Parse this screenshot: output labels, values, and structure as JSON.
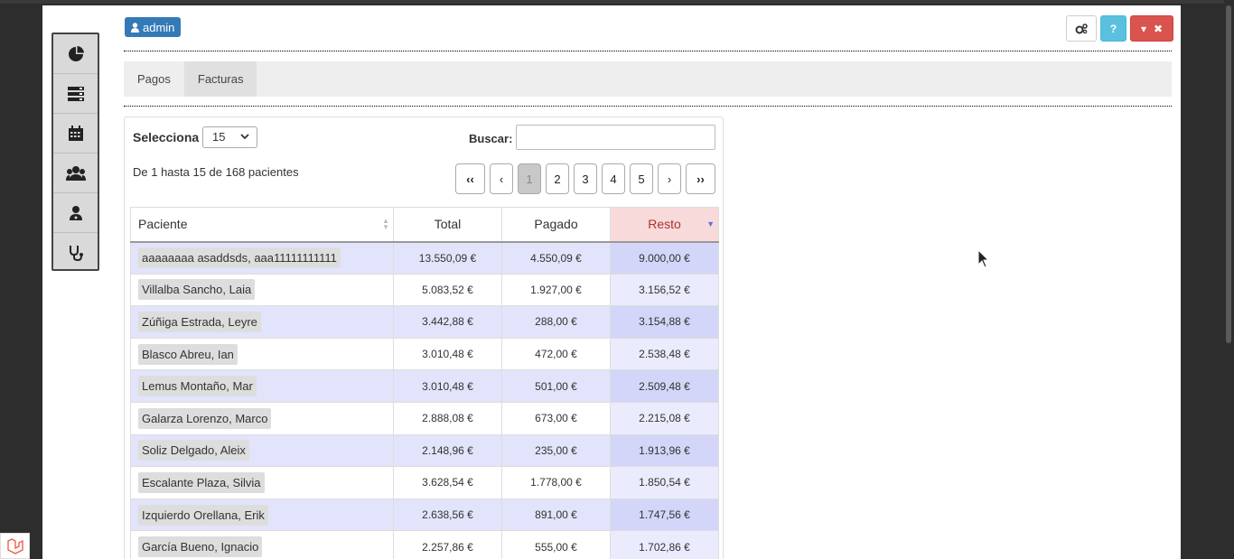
{
  "user": {
    "name": "admin"
  },
  "toolbar": {
    "help_label": "?"
  },
  "tabs": [
    {
      "label": "Pagos"
    },
    {
      "label": "Facturas"
    }
  ],
  "table_controls": {
    "select_label": "Selecciona",
    "page_size": "15",
    "search_label": "Buscar:",
    "search_value": "",
    "info": "De 1 hasta 15 de 168 pacientes"
  },
  "pagination": {
    "first": "‹‹",
    "prev": "‹",
    "pages": [
      "1",
      "2",
      "3",
      "4",
      "5"
    ],
    "current": "1",
    "next": "›",
    "last": "››"
  },
  "columns": {
    "paciente": "Paciente",
    "total": "Total",
    "pagado": "Pagado",
    "resto": "Resto"
  },
  "rows": [
    {
      "paciente": "aaaaaaaa asaddsds, aaa11111111111",
      "total": "13.550,09 €",
      "pagado": "4.550,09 €",
      "resto": "9.000,00 €"
    },
    {
      "paciente": "Villalba Sancho, Laia",
      "total": "5.083,52 €",
      "pagado": "1.927,00 €",
      "resto": "3.156,52 €"
    },
    {
      "paciente": "Zúñiga Estrada, Leyre",
      "total": "3.442,88 €",
      "pagado": "288,00 €",
      "resto": "3.154,88 €"
    },
    {
      "paciente": "Blasco Abreu, Ian",
      "total": "3.010,48 €",
      "pagado": "472,00 €",
      "resto": "2.538,48 €"
    },
    {
      "paciente": "Lemus Montaño, Mar",
      "total": "3.010,48 €",
      "pagado": "501,00 €",
      "resto": "2.509,48 €"
    },
    {
      "paciente": "Galarza Lorenzo, Marco",
      "total": "2.888,08 €",
      "pagado": "673,00 €",
      "resto": "2.215,08 €"
    },
    {
      "paciente": "Soliz Delgado, Aleix",
      "total": "2.148,96 €",
      "pagado": "235,00 €",
      "resto": "1.913,96 €"
    },
    {
      "paciente": "Escalante Plaza, Silvia",
      "total": "3.628,54 €",
      "pagado": "1.778,00 €",
      "resto": "1.850,54 €"
    },
    {
      "paciente": "Izquierdo Orellana, Erik",
      "total": "2.638,56 €",
      "pagado": "891,00 €",
      "resto": "1.747,56 €"
    },
    {
      "paciente": "García Bueno, Ignacio",
      "total": "2.257,86 €",
      "pagado": "555,00 €",
      "resto": "1.702,86 €"
    }
  ],
  "colors": {
    "primary": "#337ab7",
    "info": "#5bc0de",
    "danger": "#d9534f",
    "row_alt": "#e2e4fb",
    "sorted_header": "#f8dada"
  },
  "icons": {
    "sidebar": [
      "pie-chart-icon",
      "server-list-icon",
      "calendar-icon",
      "users-icon",
      "doctor-icon",
      "stethoscope-icon"
    ],
    "toolbar": [
      "gears-icon",
      "caret-down-icon",
      "close-icon"
    ]
  }
}
